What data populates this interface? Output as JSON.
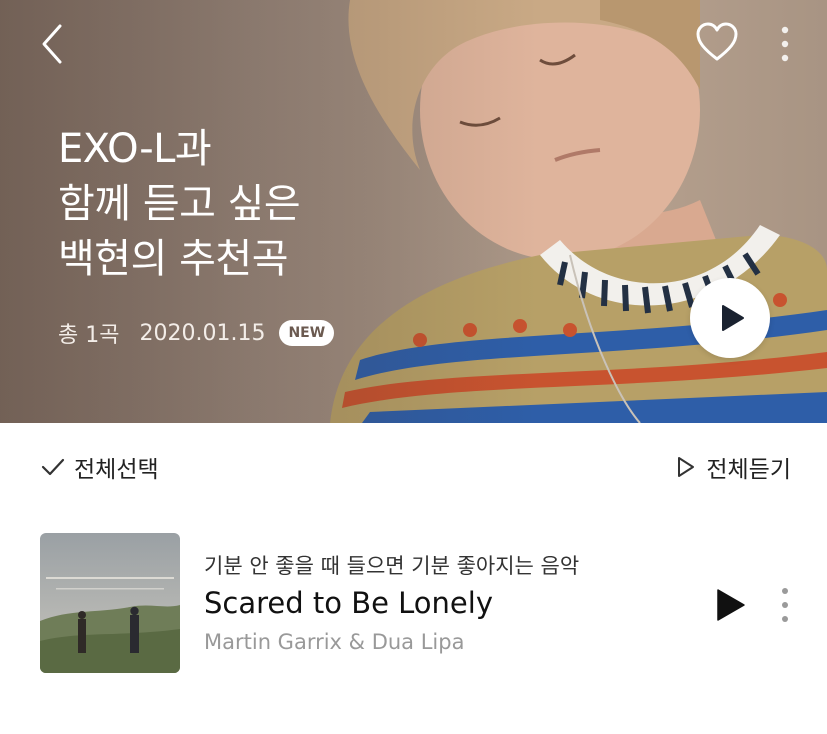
{
  "header": {
    "title_lines": [
      "EXO-L과",
      "함께 듣고 싶은",
      "백현의 추천곡"
    ],
    "track_count": "총 1곡",
    "date": "2020.01.15",
    "badge": "NEW"
  },
  "toolbar": {
    "select_all_label": "전체선택",
    "play_all_label": "전체듣기"
  },
  "tracks": [
    {
      "description": "기분 안 좋을 때 들으면 기분 좋아지는 음악",
      "title": "Scared to Be Lonely",
      "artist": "Martin Garrix & Dua Lipa"
    }
  ],
  "icons": {
    "back": "chevron-left-icon",
    "like": "heart-icon",
    "more": "more-vertical-icon",
    "play": "play-icon",
    "select": "check-icon",
    "play_all": "play-outline-icon"
  },
  "colors": {
    "hero_background": "#a69384",
    "badge_text": "#6b5a50",
    "artist_text": "#999999"
  }
}
